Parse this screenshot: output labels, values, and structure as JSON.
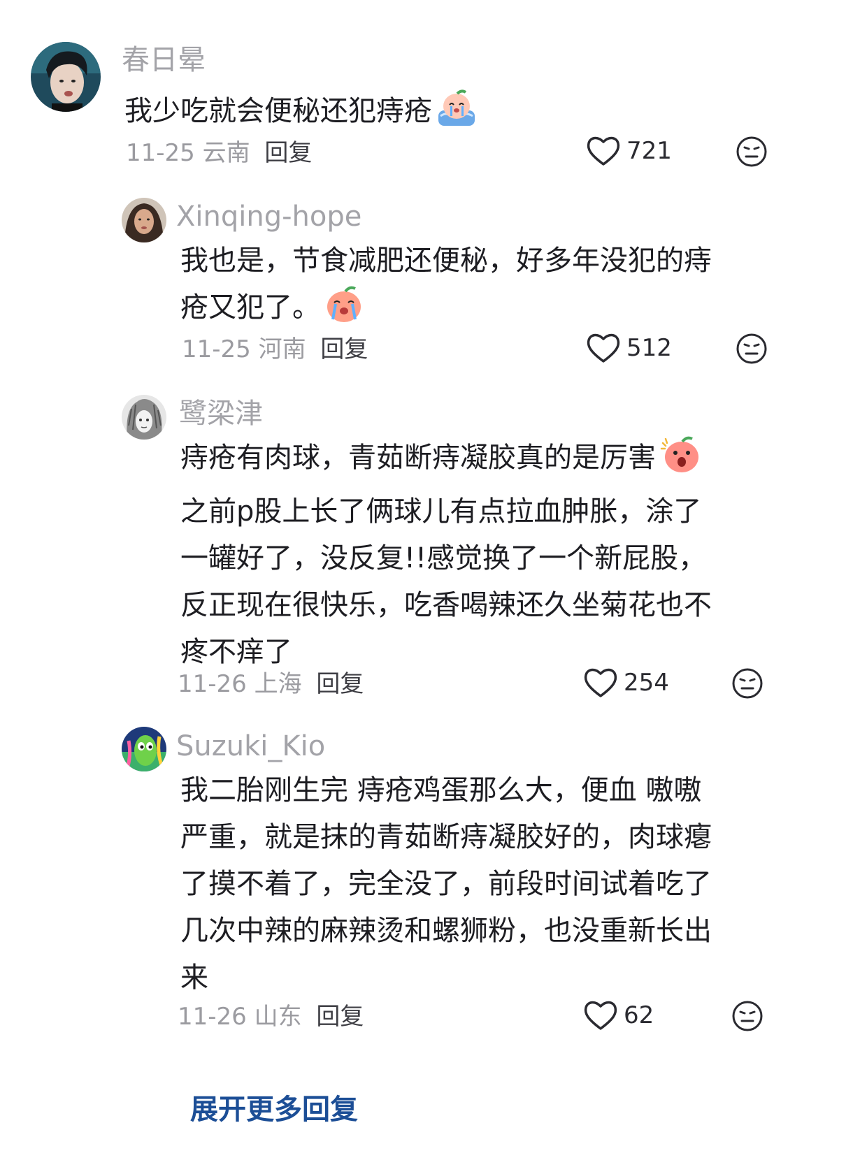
{
  "comments": [
    {
      "username": "春日晕",
      "lines": [
        "我少吃就会便秘还犯痔疮"
      ],
      "emoji": "crying-peach-emoji",
      "date": "11-25",
      "location": "云南",
      "reply": "回复",
      "likes": "721"
    },
    {
      "username": "Xinqing-hope",
      "lines": [
        "我也是，节食减肥还便秘，好多年没犯的痔",
        "疮又犯了。"
      ],
      "emoji": "sobbing-peach-emoji",
      "date": "11-25",
      "location": "河南",
      "reply": "回复",
      "likes": "512"
    },
    {
      "username": "鹭梁津",
      "lines": [
        "痔疮有肉球，青茹断痔凝胶真的是厉害",
        "之前p股上长了俩球儿有点拉血肿胀，涂了",
        "一罐好了，没反复!!感觉换了一个新屁股，",
        "反正现在很快乐，吃香喝辣还久坐菊花也不",
        "疼不痒了"
      ],
      "emoji": "shocked-peach-emoji",
      "date": "11-26",
      "location": "上海",
      "reply": "回复",
      "likes": "254"
    },
    {
      "username": "Suzuki_Kio",
      "lines": [
        "我二胎刚生完 痔疮鸡蛋那么大，便血 嗷嗷",
        "严重，就是抹的青茹断痔凝胶好的，肉球瘪",
        "了摸不着了，完全没了，前段时间试着吃了",
        "几次中辣的麻辣烫和螺狮粉，也没重新长出",
        "来"
      ],
      "date": "11-26",
      "location": "山东",
      "reply": "回复",
      "likes": "62"
    }
  ],
  "expand_label": "展开更多回复",
  "colors": {
    "username": "#a3a3a8",
    "text": "#1d1d22",
    "meta": "#9b9ba0",
    "link": "#1c4e96"
  }
}
